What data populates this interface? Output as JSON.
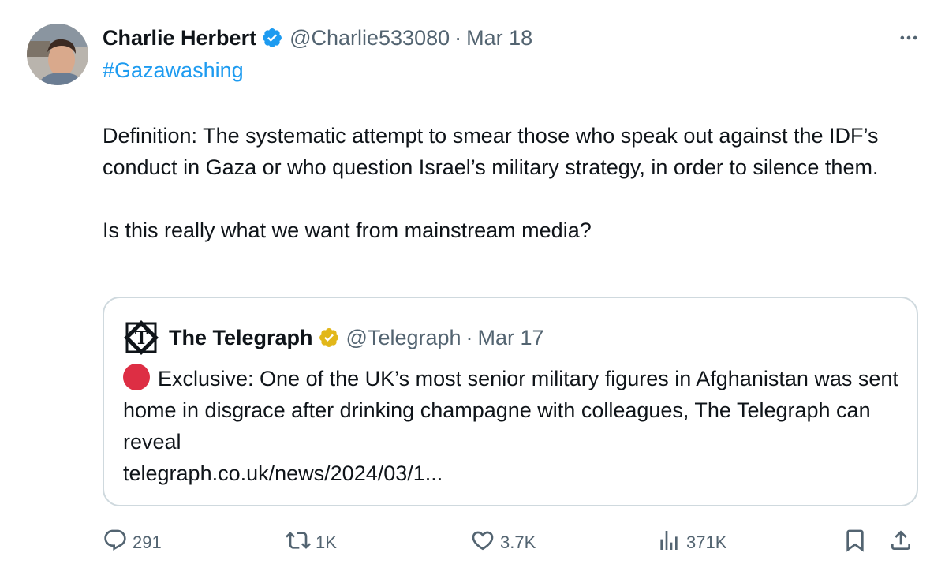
{
  "author": {
    "name": "Charlie Herbert",
    "handle": "@Charlie533080",
    "separator": "·",
    "date": "Mar 18",
    "verified_color": "#1d9bf0"
  },
  "tweet": {
    "hashtag": "#Gazawashing",
    "paragraph1": "Definition: The systematic attempt to smear those who speak out against the IDF’s conduct in Gaza or who question Israel’s military strategy, in order to silence them.",
    "paragraph2": "Is this really what we want from mainstream media?"
  },
  "quote": {
    "name": "The Telegraph",
    "handle": "@Telegraph",
    "separator": "·",
    "date": "Mar 17",
    "verified_color": "#e2b719",
    "emoji": "red-circle",
    "body": "Exclusive: One of the UK’s most senior military figures in Afghanistan was sent home in disgrace after drinking champagne with colleagues, The Telegraph can reveal",
    "link": "telegraph.co.uk/news/2024/03/1..."
  },
  "actions": {
    "replies": "291",
    "reposts": "1K",
    "likes": "3.7K",
    "views": "371K"
  },
  "icons": [
    "more-icon",
    "verified-badge-icon",
    "reply-icon",
    "repost-icon",
    "like-icon",
    "views-icon",
    "bookmark-icon",
    "share-icon"
  ]
}
